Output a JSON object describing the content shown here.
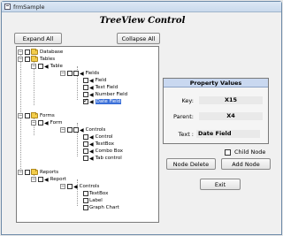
{
  "window": {
    "title": "frmSample"
  },
  "heading": "TreeView Control",
  "buttons": {
    "expand_all": "Expand All",
    "collapse_all": "Collapse All",
    "node_delete": "Node Delete",
    "add_node": "Add Node",
    "exit": "Exit"
  },
  "tree": {
    "nodes": [
      {
        "label": "Database"
      },
      {
        "label": "Tables"
      },
      {
        "label": "Table"
      },
      {
        "label": "Fields"
      },
      {
        "label": "Field"
      },
      {
        "label": "Text Field"
      },
      {
        "label": "Number Field"
      },
      {
        "label": "Date Field"
      },
      {
        "label": "Forms"
      },
      {
        "label": "Form"
      },
      {
        "label": "Controls"
      },
      {
        "label": "Control"
      },
      {
        "label": "TextBox"
      },
      {
        "label": "Combo Box"
      },
      {
        "label": "Tab control"
      },
      {
        "label": "Reports"
      },
      {
        "label": "Report"
      },
      {
        "label": "Controls"
      },
      {
        "label": "TextBox"
      },
      {
        "label": "Label"
      },
      {
        "label": "Graph Chart"
      }
    ]
  },
  "properties": {
    "title": "Property Values",
    "key_label": "Key:",
    "key_value": "X15",
    "parent_label": "Parent:",
    "parent_value": "X4",
    "text_label": "Text :",
    "text_value": "Date Field"
  },
  "child_node": {
    "label": "Child Node",
    "checked": false
  }
}
